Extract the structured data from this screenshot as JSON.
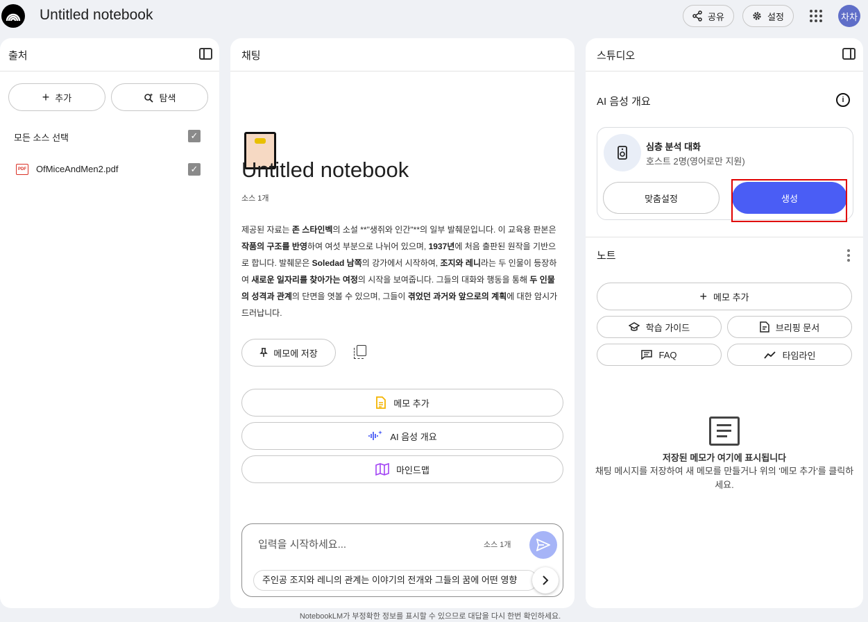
{
  "header": {
    "title": "Untitled notebook",
    "share_label": "공유",
    "settings_label": "설정",
    "avatar_text": "차차"
  },
  "sources": {
    "title": "출처",
    "add_label": "추가",
    "explore_label": "탐색",
    "select_all_label": "모든 소스 선택",
    "files": [
      {
        "name": "OfMiceAndMen2.pdf",
        "type_label": "PDF",
        "checked": true
      }
    ]
  },
  "chat": {
    "title": "채팅",
    "notebook_title": "Untitled notebook",
    "source_count": "소스 1개",
    "summary_parts": [
      {
        "t": "제공된 자료는 ",
        "b": false
      },
      {
        "t": "존 스타인벡",
        "b": true
      },
      {
        "t": "의 소설 **\"생쥐와 인간\"**의 일부 발췌문입니다. 이 교육용 판본은 ",
        "b": false
      },
      {
        "t": "작품의 구조를 반영",
        "b": true
      },
      {
        "t": "하여 여섯 부분으로 나뉘어 있으며, ",
        "b": false
      },
      {
        "t": "1937년",
        "b": true
      },
      {
        "t": "에 처음 출판된 원작을 기반으로 합니다. 발췌문은 ",
        "b": false
      },
      {
        "t": "Soledad 남쪽",
        "b": true
      },
      {
        "t": "의 강가에서 시작하여, ",
        "b": false
      },
      {
        "t": "조지와 레니",
        "b": true
      },
      {
        "t": "라는 두 인물이 등장하여 ",
        "b": false
      },
      {
        "t": "새로운 일자리를 찾아가는 여정",
        "b": true
      },
      {
        "t": "의 시작을 보여줍니다. 그들의 대화와 행동을 통해 ",
        "b": false
      },
      {
        "t": "두 인물의 성격과 관계",
        "b": true
      },
      {
        "t": "의 단면을 엿볼 수 있으며, 그들이 ",
        "b": false
      },
      {
        "t": "겪었던 과거와 앞으로의 계획",
        "b": true
      },
      {
        "t": "에 대한 암시가 드러납니다.",
        "b": false
      }
    ],
    "save_note_label": "메모에 저장",
    "actions": [
      {
        "label": "메모 추가",
        "icon": "note-icon",
        "color": "#f4b400"
      },
      {
        "label": "AI 음성 개요",
        "icon": "audio-wave-icon",
        "color": "#4a5df5"
      },
      {
        "label": "마인드맵",
        "icon": "map-icon",
        "color": "#a142f4"
      }
    ],
    "input": {
      "placeholder": "입력을 시작하세요...",
      "source_count": "소스 1개",
      "suggestion": "주인공 조지와 레니의 관계는 이야기의 전개와 그들의 꿈에 어떤 영향"
    }
  },
  "studio": {
    "title": "스튜디오",
    "audio_overview_title": "AI 음성 개요",
    "audio_card": {
      "title": "심층 분석 대화",
      "subtitle": "호스트 2명(영어로만 지원)",
      "customize_label": "맞춤설정",
      "generate_label": "생성"
    },
    "notes_title": "노트",
    "add_memo_label": "메모 추가",
    "note_buttons": [
      {
        "label": "학습 가이드",
        "icon": "graduation-cap-icon"
      },
      {
        "label": "브리핑 문서",
        "icon": "briefing-doc-icon"
      },
      {
        "label": "FAQ",
        "icon": "faq-icon"
      },
      {
        "label": "타임라인",
        "icon": "timeline-icon"
      }
    ],
    "empty_title": "저장된 메모가 여기에 표시됩니다",
    "empty_sub": "채팅 메시지를 저장하여 새 메모를 만들거나 위의 '메모 추가'를 클릭하세요."
  },
  "footer": "NotebookLM가 부정확한 정보를 표시할 수 있으므로 대답을 다시 한번 확인하세요.",
  "colors": {
    "accent": "#4a5df5",
    "highlight": "#e00000",
    "background": "#eff1f5"
  }
}
